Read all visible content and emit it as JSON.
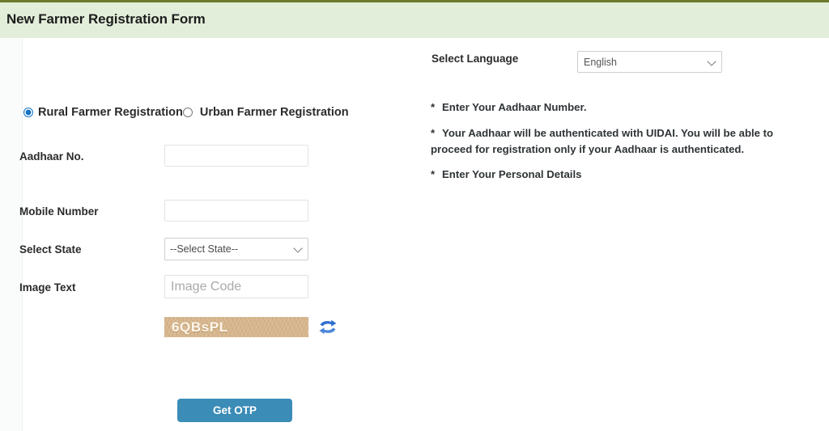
{
  "header": {
    "title": "New Farmer Registration Form",
    "band_color": "#e2eed9",
    "top_border_color": "#6b7a2c"
  },
  "form": {
    "registration_type": {
      "name": "registration-type",
      "selected": "rural",
      "options": [
        {
          "id": "rural",
          "label": "Rural Farmer Registration",
          "checked": true
        },
        {
          "id": "urban",
          "label": "Urban Farmer Registration",
          "checked": false
        }
      ]
    },
    "fields": {
      "aadhaar": {
        "label": "Aadhaar No.",
        "value": "",
        "placeholder": ""
      },
      "mobile": {
        "label": "Mobile Number",
        "value": "",
        "placeholder": ""
      },
      "state": {
        "label": "Select State",
        "selected": "--Select State--",
        "options": [
          "--Select State--"
        ]
      },
      "image_text": {
        "label": "Image Text",
        "value": "",
        "placeholder": "Image Code"
      }
    },
    "captcha": {
      "code": "6QBsPL",
      "background_color": "#d6b58c",
      "text_color": "#fdf6ec",
      "refresh_icon": "refresh-icon",
      "refresh_icon_color": "#2f6fd0"
    },
    "submit": {
      "label": "Get OTP",
      "color": "#3b8cb7"
    }
  },
  "sidebar": {
    "language": {
      "label": "Select Language",
      "selected": "English",
      "options": [
        "English"
      ]
    },
    "notes": [
      {
        "marker": "*",
        "text": "Enter Your Aadhaar Number."
      },
      {
        "marker": "*",
        "text": "Your Aadhaar will be authenticated with UIDAI. You will be able to proceed for registration only if your Aadhaar is authenticated."
      },
      {
        "marker": "*",
        "text": "Enter Your Personal Details"
      }
    ]
  }
}
